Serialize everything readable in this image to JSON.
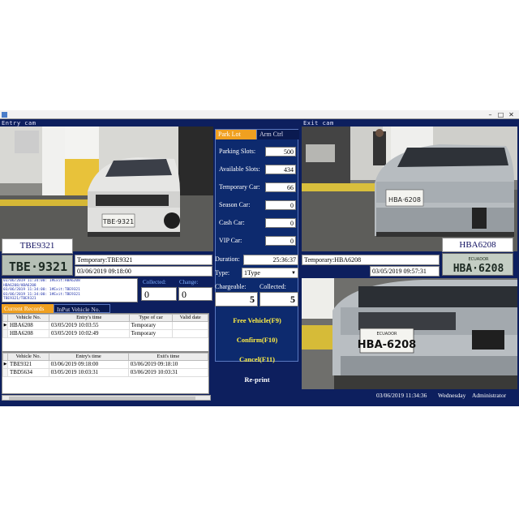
{
  "window": {
    "entry_cam_label": "Entry cam",
    "exit_cam_label": "Exit cam",
    "controls": {
      "minimize": "–",
      "maximize": "□",
      "close": "✕"
    }
  },
  "park_panel": {
    "tabs": [
      "Park Lot",
      "Arm Ctrl"
    ],
    "stats": [
      {
        "label": "Parking Slots:",
        "value": "500"
      },
      {
        "label": "Available Slots:",
        "value": "434"
      },
      {
        "label": "Temporary Car:",
        "value": "66"
      },
      {
        "label": "Season Car:",
        "value": "0"
      },
      {
        "label": "Cash Car:",
        "value": "0"
      },
      {
        "label": "VIP Car:",
        "value": "0"
      }
    ]
  },
  "entry": {
    "plate_text": "TBE9321",
    "plate_image_text": "TBE·9321",
    "temporary": "Temporary:TBE9321",
    "time": "03/06/2019 09:18:00",
    "collected_label": "Collected:",
    "change_label": "Change:",
    "collected_value": "0",
    "change_value": "0"
  },
  "exit": {
    "plate_text": "HBA6208",
    "plate_image_text": "HBA·6208",
    "plate_country": "ECUADOR",
    "temporary": "Temporary:HBA6208",
    "time": "03/05/2019 09:57:31"
  },
  "cars": {
    "entry_plate": "TBE·9321",
    "exit_plate_small": "HBA·6208",
    "exit_plate_large": "HBA-6208",
    "exit_plate_country": "ECUADOR"
  },
  "billing": {
    "duration_label": "Duration:",
    "duration_value": "25:36:37",
    "type_label": "Type:",
    "type_value": "1Type",
    "chargeable_label": "Chargeable:",
    "chargeable_value": "5",
    "collected_label": "Collected:",
    "collected_value": "5"
  },
  "log_lines": [
    "03/06/2019 11:34:00: 1#Exit:HBA6208",
    "HBA6208/HBA6208",
    "03/06/2019 11:34:00: 1#Exit:TBE9321",
    "03/06/2019 11:34:00: 1#Exit:TBE9321",
    "TBE9321/TBE9321"
  ],
  "records_tabs": [
    "Current Records",
    "InPut Vehicle No."
  ],
  "current_records": {
    "columns": [
      "Vehicle No.",
      "Entry's time",
      "Type of car",
      "Valid date"
    ],
    "rows": [
      {
        "vehicle": "HBA6208",
        "entry": "03/05/2019 10:03:55",
        "type": "Temporary",
        "valid": ""
      },
      {
        "vehicle": "HBA6208",
        "entry": "03/05/2019 10:02:49",
        "type": "Temporary",
        "valid": ""
      }
    ]
  },
  "exit_records": {
    "columns": [
      "Vehicle No.",
      "Entry's time",
      "Exit's time"
    ],
    "rows": [
      {
        "vehicle": "TBE9321",
        "entry": "03/06/2019 09:18:00",
        "exit": "03/06/2019 09:18:10"
      },
      {
        "vehicle": "TBD5634",
        "entry": "03/05/2019 10:03:31",
        "exit": "03/06/2019 10:03:31"
      }
    ]
  },
  "actions": {
    "free_vehicle": "Free Vehicle(F9)",
    "confirm": "Confirm(F10)",
    "cancel": "Cancel(F11)",
    "reprint": "Re-print"
  },
  "status": {
    "datetime": "03/06/2019  11:34:36",
    "weekday": "Wednesday",
    "user": "Administrator"
  },
  "colors": {
    "window_bg": "#0d1f5e",
    "accent_tab": "#f0a020",
    "action_text": "#ffee44"
  }
}
